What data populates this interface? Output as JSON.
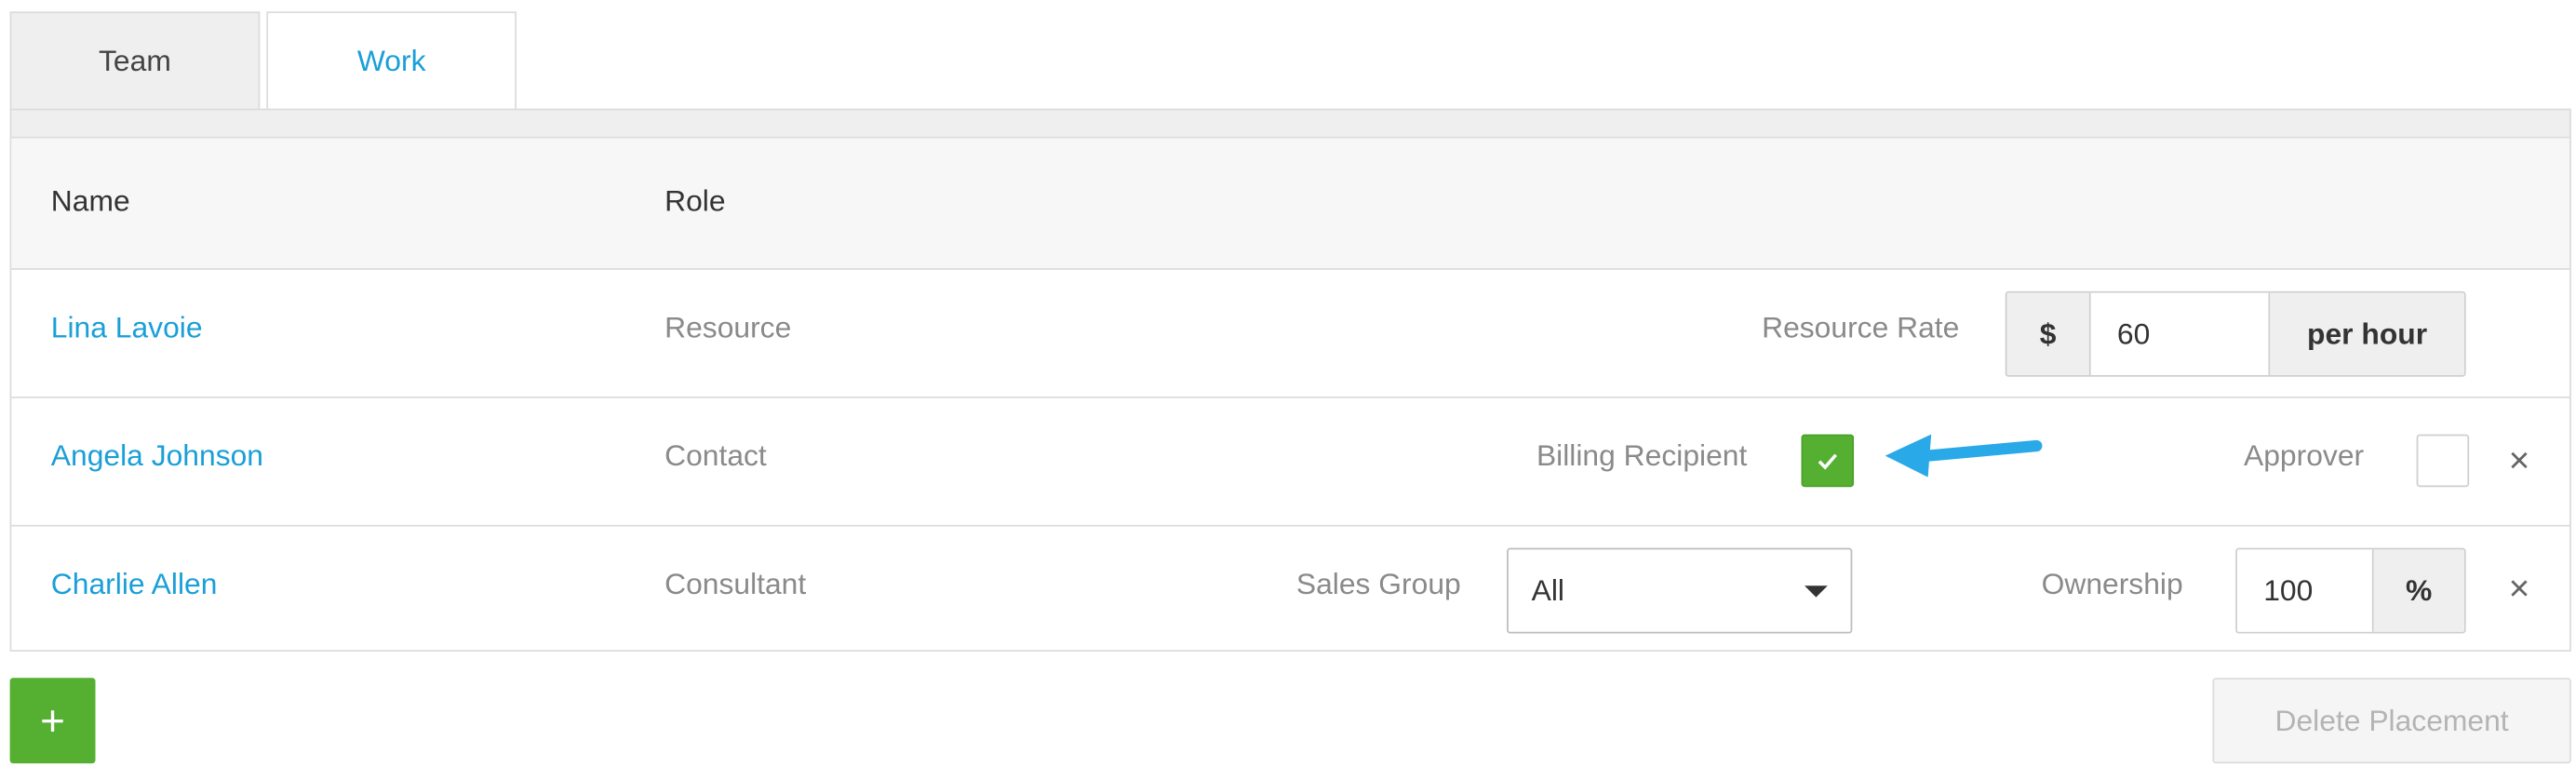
{
  "tabs": [
    {
      "label": "Team",
      "active": true
    },
    {
      "label": "Work",
      "active": false
    }
  ],
  "table": {
    "headers": {
      "name": "Name",
      "role": "Role"
    },
    "rows": [
      {
        "name": "Lina Lavoie",
        "role": "Resource",
        "rate_label": "Resource Rate",
        "rate_prefix": "$",
        "rate_value": "60",
        "rate_suffix": "per hour"
      },
      {
        "name": "Angela Johnson",
        "role": "Contact",
        "billing_label": "Billing Recipient",
        "billing_checked": true,
        "approver_label": "Approver",
        "approver_checked": false,
        "remove": "×"
      },
      {
        "name": "Charlie Allen",
        "role": "Consultant",
        "sales_group_label": "Sales Group",
        "sales_group_value": "All",
        "ownership_label": "Ownership",
        "ownership_value": "100",
        "ownership_suffix": "%",
        "remove": "×"
      }
    ]
  },
  "actions": {
    "add": "+",
    "delete": "Delete Placement"
  },
  "colors": {
    "accent": "#1a9fd8",
    "green": "#55b032",
    "arrow": "#29a9e8"
  },
  "icons": {
    "check": "check-icon",
    "caret": "caret-down-icon",
    "close": "close-icon",
    "arrow": "arrow-left-icon"
  }
}
